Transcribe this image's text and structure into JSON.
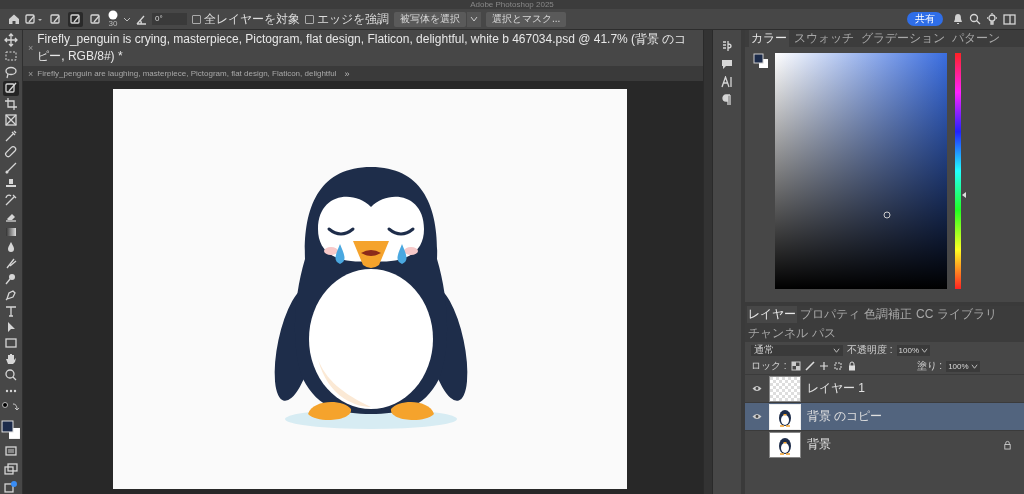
{
  "window": {
    "title": "Adobe Photoshop 2025"
  },
  "options_bar": {
    "brush_size": "30",
    "angle": "0°",
    "checkboxes": [
      {
        "label": "全レイヤーを対象",
        "checked": false
      },
      {
        "label": "エッジを強調",
        "checked": false
      }
    ],
    "buttons": [
      "被写体を選択",
      "選択とマスク..."
    ],
    "share_button": "共有"
  },
  "document_tabs": [
    {
      "close": "×",
      "label": "Firefly_penguin is crying, masterpiece, Pictogram, flat design, Flaticon, delightful, white b 467034.psd @ 41.7% (背景 のコピー, RGB/8#) *",
      "selected": true
    },
    {
      "close": "×",
      "label": "Firefly_penguin are laughing, masterpiece, Pictogram, flat design, Flaticon, delightful",
      "selected": false
    }
  ],
  "tabs_overflow": "»",
  "tools": [
    {
      "kind": "move",
      "selected": false
    },
    {
      "kind": "marquee",
      "selected": false
    },
    {
      "kind": "lasso",
      "selected": false
    },
    {
      "kind": "quick-select",
      "selected": true
    },
    {
      "kind": "crop",
      "selected": false
    },
    {
      "kind": "frame",
      "selected": false
    },
    {
      "kind": "eyedropper",
      "selected": false
    },
    {
      "kind": "healing",
      "selected": false
    },
    {
      "kind": "brush",
      "selected": false
    },
    {
      "kind": "stamp",
      "selected": false
    },
    {
      "kind": "history-brush",
      "selected": false
    },
    {
      "kind": "eraser",
      "selected": false
    },
    {
      "kind": "gradient",
      "selected": false
    },
    {
      "kind": "blur",
      "selected": false
    },
    {
      "kind": "smudge",
      "selected": false
    },
    {
      "kind": "dodge",
      "selected": false
    },
    {
      "kind": "pen",
      "selected": false
    },
    {
      "kind": "type",
      "selected": false
    },
    {
      "kind": "path-select",
      "selected": false
    },
    {
      "kind": "rectangle",
      "selected": false
    },
    {
      "kind": "hand",
      "selected": false
    },
    {
      "kind": "zoom",
      "selected": false
    },
    {
      "kind": "more",
      "selected": false
    }
  ],
  "color_panel": {
    "hue_slider": {
      "level": 0.4
    },
    "tabs": [
      {
        "label": "カラー",
        "selected": true
      },
      {
        "label": "スウォッチ",
        "selected": false
      },
      {
        "label": "グラデーション",
        "selected": false
      },
      {
        "label": "パターン",
        "selected": false
      }
    ]
  },
  "layers_panel": {
    "tabs": [
      {
        "label": "レイヤー",
        "selected": true
      },
      {
        "label": "プロパティ",
        "selected": false
      },
      {
        "label": "色調補正",
        "selected": false
      },
      {
        "label": "CC ライブラリ",
        "selected": false
      },
      {
        "label": "チャンネル",
        "selected": false
      },
      {
        "label": "パス",
        "selected": false
      }
    ],
    "blend_mode": "通常",
    "opacity_label": "不透明度 :",
    "opacity": "100%",
    "lock_label": "ロック :",
    "fill_label": "塗り :",
    "fill": "100%",
    "layers": [
      {
        "name": "レイヤー 1",
        "visible": true,
        "selected": false,
        "locked": false,
        "kind": "transparent"
      },
      {
        "name": "背景 のコピー",
        "visible": true,
        "selected": true,
        "locked": false,
        "kind": "penguin"
      },
      {
        "name": "背景",
        "visible": false,
        "selected": false,
        "locked": true,
        "kind": "penguin"
      }
    ]
  }
}
